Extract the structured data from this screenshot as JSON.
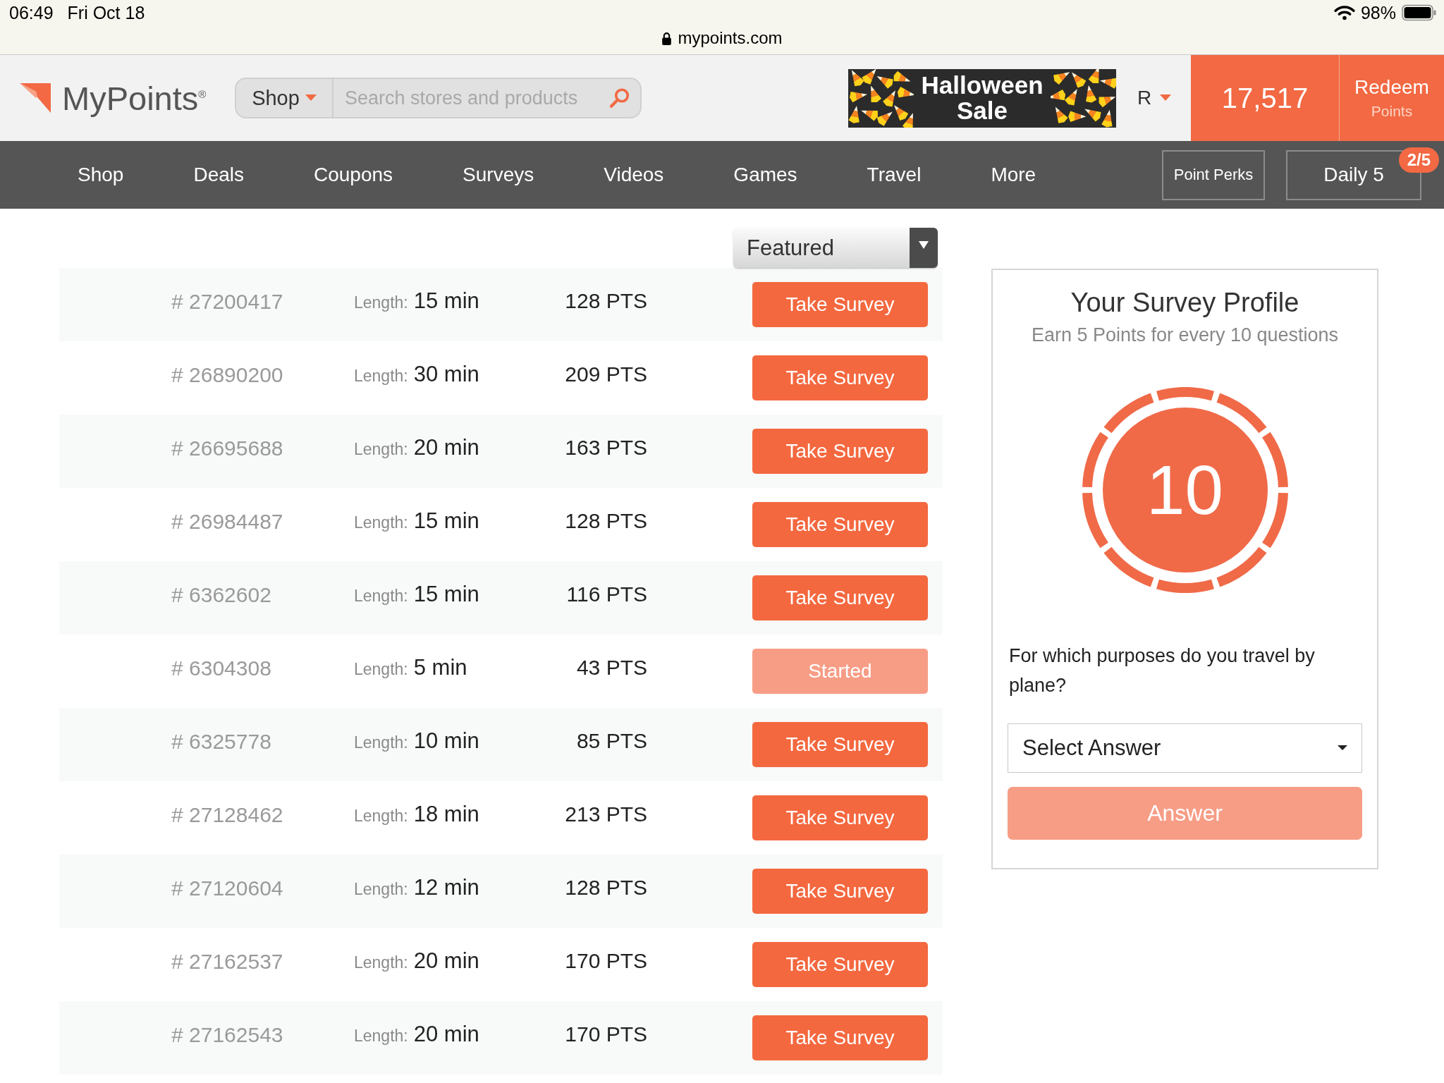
{
  "status_bar": {
    "time": "06:49",
    "date": "Fri Oct 18",
    "url": "mypoints.com",
    "battery": "98%"
  },
  "header": {
    "logo": "MyPoints$^{®}$",
    "category": "Shop",
    "search_placeholder": "Search stores and products",
    "banner": "Halloween Sale",
    "account": "R",
    "points": "17,517",
    "redeem": {
      "title": "Redeem",
      "subtitle": "Points"
    }
  },
  "nav": {
    "items": [
      {
        "label": "Shop"
      },
      {
        "label": "Deals"
      },
      {
        "label": "Coupons"
      },
      {
        "label": "Surveys"
      },
      {
        "label": "Videos"
      },
      {
        "label": "Games"
      },
      {
        "label": "Travel"
      },
      {
        "label": "More"
      }
    ],
    "buttons": [
      {
        "label": "Point Perks"
      },
      {
        "label": "Daily 5",
        "badge": "2/5"
      }
    ]
  },
  "sort": {
    "value": "Featured"
  },
  "surveys": [
    {
      "number": "# 27200417",
      "length_label": "Length:",
      "length": "15 min",
      "points": "128 PTS",
      "button": "Take Survey",
      "started": false
    },
    {
      "number": "# 26890200",
      "length_label": "Length:",
      "length": "30 min",
      "points": "209 PTS",
      "button": "Take Survey",
      "started": false
    },
    {
      "number": "# 26695688",
      "length_label": "Length:",
      "length": "20 min",
      "points": "163 PTS",
      "button": "Take Survey",
      "started": false
    },
    {
      "number": "# 26984487",
      "length_label": "Length:",
      "length": "15 min",
      "points": "128 PTS",
      "button": "Take Survey",
      "started": false
    },
    {
      "number": "# 6362602",
      "length_label": "Length:",
      "length": "15 min",
      "points": "116 PTS",
      "button": "Take Survey",
      "started": false
    },
    {
      "number": "# 6304308",
      "length_label": "Length:",
      "length": "5 min",
      "points": "43 PTS",
      "button": "Started",
      "started": true
    },
    {
      "number": "# 6325778",
      "length_label": "Length:",
      "length": "10 min",
      "points": "85 PTS",
      "button": "Take Survey",
      "started": false
    },
    {
      "number": "# 27128462",
      "length_label": "Length:",
      "length": "18 min",
      "points": "213 PTS",
      "button": "Take Survey",
      "started": false
    },
    {
      "number": "# 27120604",
      "length_label": "Length:",
      "length": "12 min",
      "points": "128 PTS",
      "button": "Take Survey",
      "started": false
    },
    {
      "number": "# 27162537",
      "length_label": "Length:",
      "length": "20 min",
      "points": "170 PTS",
      "button": "Take Survey",
      "started": false
    },
    {
      "number": "# 27162543",
      "length_label": "Length:",
      "length": "20 min",
      "points": "170 PTS",
      "button": "Take Survey",
      "started": false
    }
  ],
  "profile": {
    "title": "Your Survey Profile",
    "subtitle": "Earn 5 Points for every 10 questions",
    "count": "10",
    "question": "For which purposes do you travel by plane?",
    "answer_dropdown": {
      "value": "Select Answer"
    },
    "answer_button": {
      "label": "Answer",
      "disabled": true
    }
  }
}
